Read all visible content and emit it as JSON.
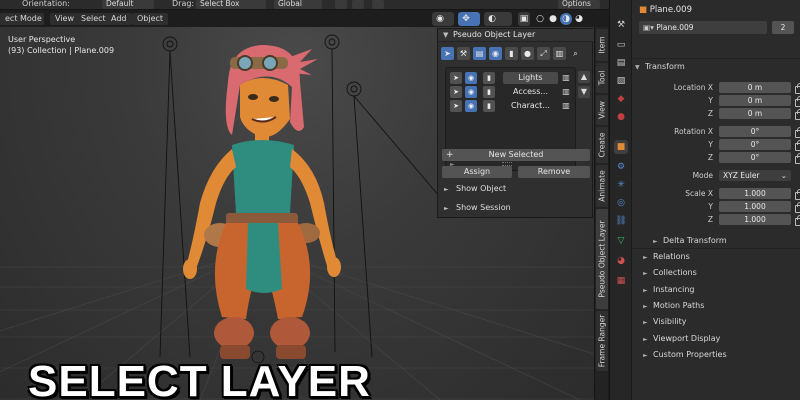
{
  "topbar": {
    "orientation_label": "Orientation:",
    "orientation_value": "Default",
    "drag_label": "Drag:",
    "drag_value": "Select Box",
    "transform_space": "Global",
    "options_label": "Options"
  },
  "menubar": {
    "mode": "ect Mode",
    "view": "View",
    "select": "Select",
    "add": "Add",
    "object": "Object"
  },
  "viewport": {
    "perspective": "User Perspective",
    "collection_info": "(93) Collection | Plane.009",
    "caption": "SELECT LAYER"
  },
  "addon_panel": {
    "title": "Pseudo Object Layer",
    "layers": [
      {
        "name": "Lights",
        "active": true
      },
      {
        "name": "Access...",
        "active": false
      },
      {
        "name": "Charact...",
        "active": false
      }
    ],
    "new_selected_label": "New Selected",
    "assign_label": "Assign",
    "remove_label": "Remove",
    "show_object_label": "Show Object",
    "show_session_label": "Show Session"
  },
  "sidebar_tabs": [
    {
      "label": "Item"
    },
    {
      "label": "Tool"
    },
    {
      "label": "View"
    },
    {
      "label": "Create"
    },
    {
      "label": "Animate"
    },
    {
      "label": "Pseudo Object Layer"
    },
    {
      "label": "Frame Ranger"
    }
  ],
  "properties": {
    "object_name": "Plane.009",
    "datablock_name": "Plane.009",
    "user_count": "2",
    "transform_header": "Transform",
    "location_label": "Location X",
    "rotation_label": "Rotation X",
    "scale_label": "Scale X",
    "y_label": "Y",
    "z_label": "Z",
    "mode_label": "Mode",
    "location": [
      "0 m",
      "0 m",
      "0 m"
    ],
    "rotation": [
      "0°",
      "0°",
      "0°"
    ],
    "mode_value": "XYZ Euler",
    "scale": [
      "1.000",
      "1.000",
      "1.000"
    ],
    "delta_transform": "Delta Transform",
    "sections": [
      "Relations",
      "Collections",
      "Instancing",
      "Motion Paths",
      "Visibility",
      "Viewport Display",
      "Custom Properties"
    ]
  },
  "colors": {
    "accent_blue": "#4772b3",
    "header_bg": "#2b2b2b",
    "panel_bg": "#2f2f2f",
    "object_orange": "#e08a36"
  }
}
